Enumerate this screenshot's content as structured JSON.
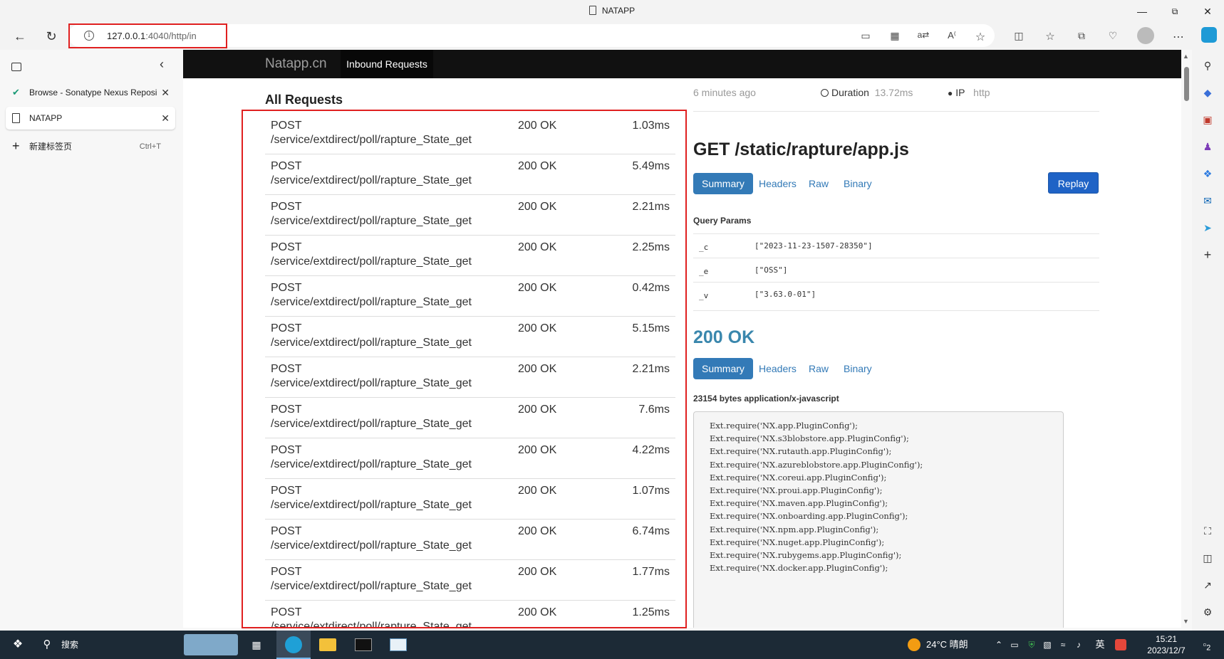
{
  "window": {
    "title": "NATAPP"
  },
  "address_bar": {
    "url_host": "127.0.0.1",
    "url_rest": ":4040/http/in"
  },
  "tabs_sidebar": {
    "tabs": [
      {
        "label": "Browse - Sonatype Nexus Reposi"
      },
      {
        "label": "NATAPP"
      }
    ],
    "new_tab_label": "新建标签页",
    "new_tab_shortcut": "Ctrl+T"
  },
  "navbar": {
    "brand": "Natapp.cn",
    "active_item": "Inbound Requests"
  },
  "requests": {
    "heading": "All Requests",
    "rows": [
      {
        "method": "POST",
        "path": "/service/extdirect/poll/rapture_State_get",
        "status": "200 OK",
        "duration": "1.03ms"
      },
      {
        "method": "POST",
        "path": "/service/extdirect/poll/rapture_State_get",
        "status": "200 OK",
        "duration": "5.49ms"
      },
      {
        "method": "POST",
        "path": "/service/extdirect/poll/rapture_State_get",
        "status": "200 OK",
        "duration": "2.21ms"
      },
      {
        "method": "POST",
        "path": "/service/extdirect/poll/rapture_State_get",
        "status": "200 OK",
        "duration": "2.25ms"
      },
      {
        "method": "POST",
        "path": "/service/extdirect/poll/rapture_State_get",
        "status": "200 OK",
        "duration": "0.42ms"
      },
      {
        "method": "POST",
        "path": "/service/extdirect/poll/rapture_State_get",
        "status": "200 OK",
        "duration": "5.15ms"
      },
      {
        "method": "POST",
        "path": "/service/extdirect/poll/rapture_State_get",
        "status": "200 OK",
        "duration": "2.21ms"
      },
      {
        "method": "POST",
        "path": "/service/extdirect/poll/rapture_State_get",
        "status": "200 OK",
        "duration": "7.6ms"
      },
      {
        "method": "POST",
        "path": "/service/extdirect/poll/rapture_State_get",
        "status": "200 OK",
        "duration": "4.22ms"
      },
      {
        "method": "POST",
        "path": "/service/extdirect/poll/rapture_State_get",
        "status": "200 OK",
        "duration": "1.07ms"
      },
      {
        "method": "POST",
        "path": "/service/extdirect/poll/rapture_State_get",
        "status": "200 OK",
        "duration": "6.74ms"
      },
      {
        "method": "POST",
        "path": "/service/extdirect/poll/rapture_State_get",
        "status": "200 OK",
        "duration": "1.77ms"
      },
      {
        "method": "POST",
        "path": "/service/extdirect/poll/rapture_State_get",
        "status": "200 OK",
        "duration": "1.25ms"
      }
    ]
  },
  "detail": {
    "time_ago": "6 minutes ago",
    "duration_label": "Duration",
    "duration_value": "13.72ms",
    "ip_label": "IP",
    "ip_value": "http",
    "request_title": "GET /static/rapture/app.js",
    "tabs": [
      "Summary",
      "Headers",
      "Raw",
      "Binary"
    ],
    "replay_label": "Replay",
    "query_params_label": "Query Params",
    "query_params": [
      {
        "key": "_c",
        "value": "[\"2023-11-23-1507-28350\"]"
      },
      {
        "key": "_e",
        "value": "[\"OSS\"]"
      },
      {
        "key": "_v",
        "value": "[\"3.63.0-01\"]"
      }
    ],
    "response_status": "200 OK",
    "response_tabs": [
      "Summary",
      "Headers",
      "Raw",
      "Binary"
    ],
    "response_meta": "23154 bytes application/x-javascript",
    "code_lines": [
      "Ext.require('NX.app.PluginConfig');",
      "Ext.require('NX.s3blobstore.app.PluginConfig');",
      "Ext.require('NX.rutauth.app.PluginConfig');",
      "Ext.require('NX.azureblobstore.app.PluginConfig');",
      "Ext.require('NX.coreui.app.PluginConfig');",
      "Ext.require('NX.proui.app.PluginConfig');",
      "Ext.require('NX.maven.app.PluginConfig');",
      "Ext.require('NX.onboarding.app.PluginConfig');",
      "Ext.require('NX.npm.app.PluginConfig');",
      "Ext.require('NX.nuget.app.PluginConfig');",
      "Ext.require('NX.rubygems.app.PluginConfig');",
      "Ext.require('NX.docker.app.PluginConfig');"
    ]
  },
  "taskbar": {
    "search_label": "搜索",
    "weather": "24°C 晴朗",
    "ime": "英",
    "time": "15:21",
    "date": "2023/12/7",
    "notification_count": "2"
  },
  "colors": {
    "highlight": "#e02020",
    "primary": "#337ab7",
    "status_ok": "#3a87ad"
  }
}
